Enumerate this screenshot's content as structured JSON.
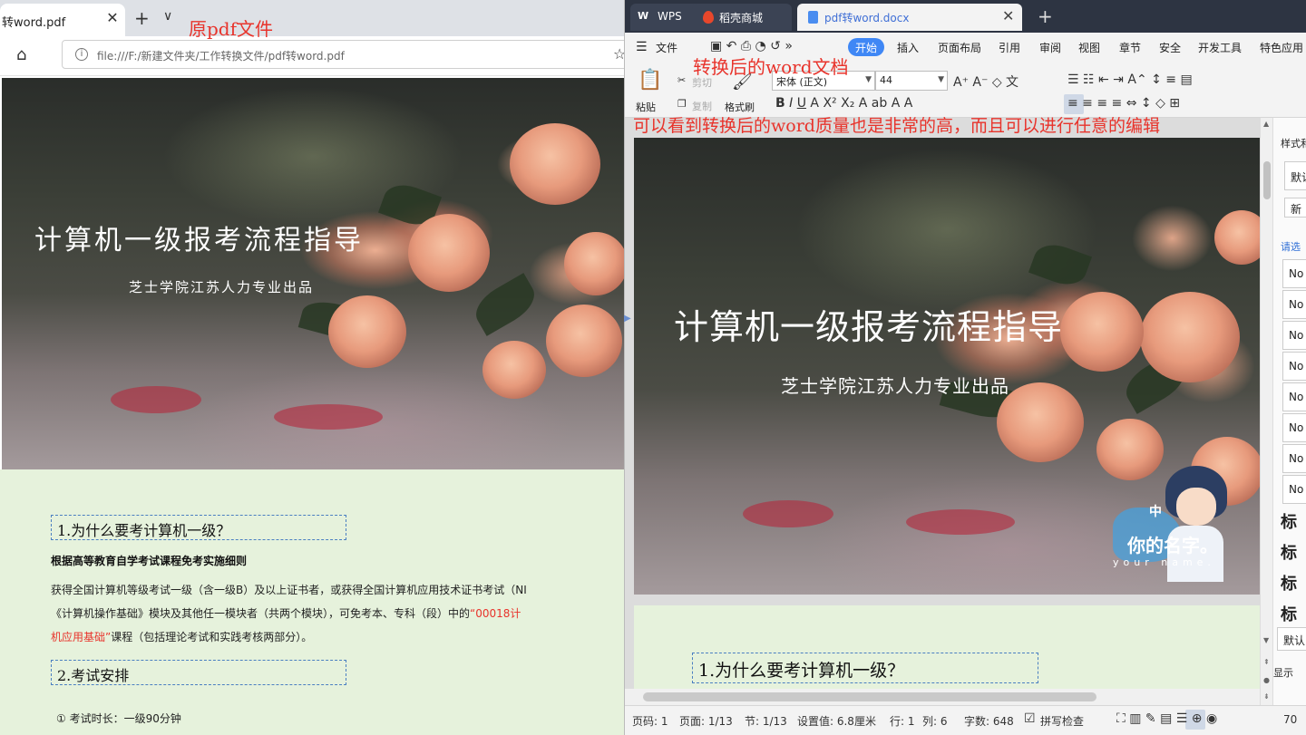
{
  "browser": {
    "tab_title": "转word.pdf",
    "address": "file:///F:/新建文件夹/工作转换文件/pdf转word.pdf"
  },
  "annotations": {
    "original": "原pdf文件",
    "converted": "转换后的word文档",
    "note": "可以看到转换后的word质量也是非常的高，而且可以进行任意的编辑"
  },
  "pdf": {
    "cover_title": "计算机一级报考流程指导",
    "cover_subtitle": "芝士学院江苏人力专业出品",
    "section1": "1.为什么要考计算机一级？",
    "rule_title": "根据高等教育自学考试课程免考实施细则",
    "para_line1": "获得全国计算机等级考试一级（含一级B）及以上证书者，或获得全国计算机应用技术证书考试（NI",
    "para_line2_a": "《计算机操作基础》模块及其他任一模块者（共两个模块），可免考本、专科（段）中的",
    "para_line2_red": "“00018计",
    "para_line3_red": "机应用基础”",
    "para_line3_b": "课程（包括理论考试和实践考核两部分）。",
    "section2": "2.考试安排",
    "exam_item": "①  考试时长：一级90分钟"
  },
  "wps": {
    "tabs": [
      {
        "label": "WPS"
      },
      {
        "label": "稻壳商城"
      },
      {
        "label": "pdf转word.docx"
      }
    ],
    "menu": [
      "文件",
      "开始",
      "插入",
      "页面布局",
      "引用",
      "审阅",
      "视图",
      "章节",
      "安全",
      "开发工具",
      "特色应用"
    ],
    "ribbon": {
      "paste": "粘贴",
      "cut": "剪切",
      "copy": "复制",
      "format_painter": "格式刷",
      "font_name": "宋体 (正文)",
      "font_size": "44"
    },
    "doc": {
      "cover_title": "计算机一级报考流程指导",
      "cover_subtitle": "芝士学院江苏人力专业出品",
      "section1": "1.为什么要考计算机一级？",
      "logo_top": "中",
      "logo_cn": "你的名字。",
      "logo_en": "your name."
    },
    "side": {
      "header": "样式和",
      "default1": "默认",
      "new": "新",
      "select": "请选",
      "items": [
        "No",
        "No",
        "No",
        "No",
        "No",
        "No",
        "No",
        "No"
      ],
      "headings": [
        "标",
        "标",
        "标",
        "标"
      ],
      "default2": "默认",
      "show": "显示"
    },
    "status": {
      "page_no": "页码: 1",
      "pages": "页面: 1/13",
      "section": "节: 1/13",
      "setting": "设置值: 6.8厘米",
      "row": "行: 1",
      "col": "列: 6",
      "words": "字数: 648",
      "spell": "拼写检查",
      "zoom": "70"
    }
  }
}
